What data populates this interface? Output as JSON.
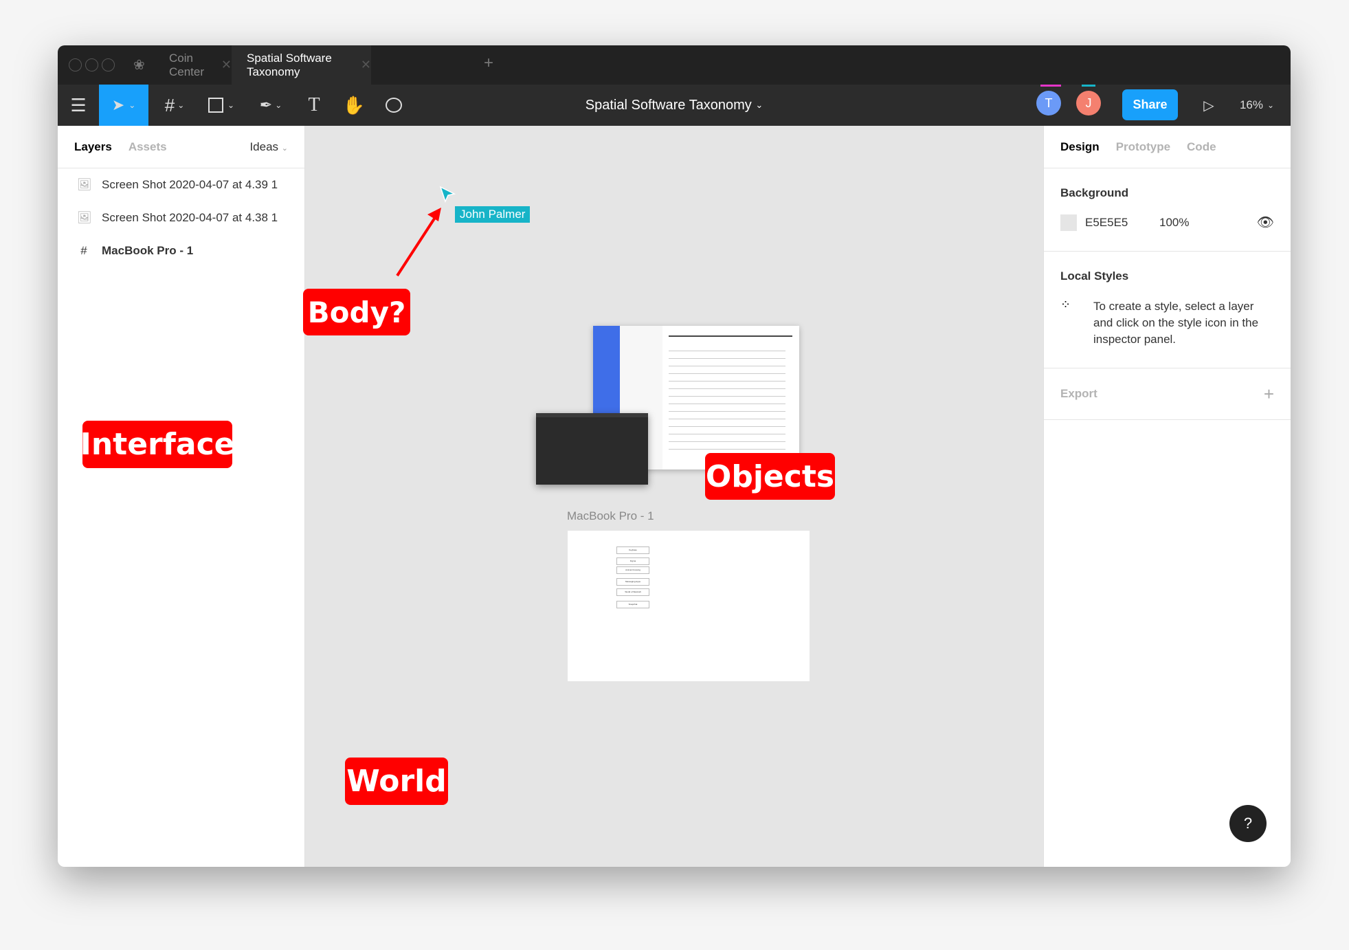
{
  "tabs": [
    {
      "label": "Coin Center"
    },
    {
      "label": "Spatial Software Taxonomy"
    }
  ],
  "toolbar": {
    "doc_title": "Spatial Software Taxonomy",
    "share": "Share",
    "zoom": "16%",
    "avatars": [
      {
        "initial": "T",
        "color": "#6b9af7",
        "bar": "#e535c8"
      },
      {
        "initial": "J",
        "color": "#f4806f",
        "bar": "#17b4c8"
      }
    ],
    "accent": "#18a0fb"
  },
  "left": {
    "tabs": [
      "Layers",
      "Assets"
    ],
    "page": "Ideas",
    "layers": [
      {
        "name": "Screen Shot 2020-04-07 at 4.39 1",
        "icon": "image-icon"
      },
      {
        "name": "Screen Shot 2020-04-07 at 4.38 1",
        "icon": "image-icon"
      },
      {
        "name": "MacBook Pro - 1",
        "icon": "frame-icon"
      }
    ]
  },
  "right": {
    "tabs": [
      "Design",
      "Prototype",
      "Code"
    ],
    "background": {
      "title": "Background",
      "hex": "E5E5E5",
      "opacity": "100%"
    },
    "local_styles": {
      "title": "Local Styles",
      "hint": "To create a style, select a layer and click on the style icon in the inspector panel."
    },
    "export": {
      "title": "Export"
    },
    "help": "?"
  },
  "canvas": {
    "cursor_user": "John Palmer",
    "labels": {
      "body": "Body?",
      "interface": "Interface",
      "objects": "Objects",
      "world": "World"
    },
    "frame": {
      "name": "MacBook Pro - 1",
      "buttons": [
        "Keybase",
        "Figma",
        "Animal Crossing",
        "Messaging Apps",
        "World of Warcraft",
        "Snapchat"
      ]
    }
  }
}
